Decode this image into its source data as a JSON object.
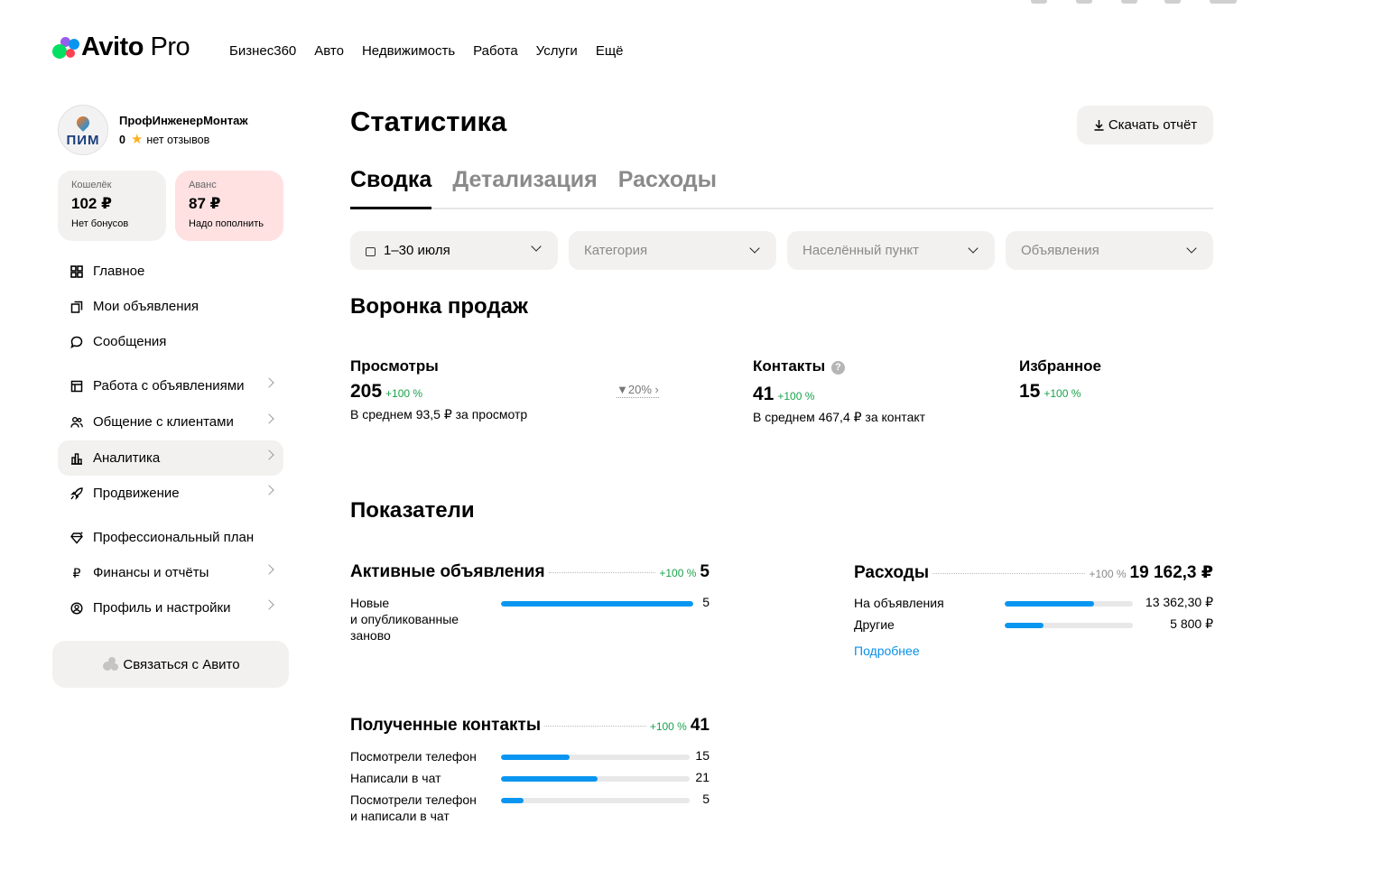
{
  "header": {
    "logo_main": "Avito",
    "logo_pro": "Pro",
    "nav": [
      "Бизнес360",
      "Авто",
      "Недвижимость",
      "Работа",
      "Услуги",
      "Ещё"
    ]
  },
  "profile": {
    "name": "ПрофИнженерМонтаж",
    "avatar_text": "ПИМ",
    "rating": "0",
    "reviews": "нет отзывов"
  },
  "wallet": {
    "label": "Кошелёк",
    "value": "102 ₽",
    "sub": "Нет бонусов"
  },
  "advance": {
    "label": "Аванс",
    "value": "87 ₽",
    "sub": "Надо пополнить"
  },
  "menu": [
    {
      "label": "Главное"
    },
    {
      "label": "Мои объявления"
    },
    {
      "label": "Сообщения"
    },
    {
      "label": "Работа с объявлениями"
    },
    {
      "label": "Общение с клиентами"
    },
    {
      "label": "Аналитика"
    },
    {
      "label": "Продвижение"
    },
    {
      "label": "Профессиональный план"
    },
    {
      "label": "Финансы и отчёты"
    },
    {
      "label": "Профиль и настройки"
    }
  ],
  "contact_button": "Связаться с Авито",
  "page": {
    "title": "Статистика",
    "download": "Скачать отчёт",
    "tabs": [
      "Сводка",
      "Детализация",
      "Расходы"
    ]
  },
  "filters": {
    "period": "1–30 июля",
    "category": "Категория",
    "location": "Населённый пункт",
    "ads": "Объявления"
  },
  "funnel": {
    "title": "Воронка продаж",
    "views": {
      "label": "Просмотры",
      "value": "205",
      "change": "+100 %",
      "sub": "В среднем 93,5 ₽ за просмотр"
    },
    "conversion": "20%",
    "contacts": {
      "label": "Контакты",
      "help": "?",
      "value": "41",
      "change": "+100 %",
      "sub": "В среднем 467,4 ₽ за контакт"
    },
    "favorites": {
      "label": "Избранное",
      "value": "15",
      "change": "+100 %"
    }
  },
  "indicators": {
    "title": "Показатели",
    "active_ads": {
      "label": "Активные объявления",
      "change": "+100 %",
      "value": "5",
      "rows": [
        {
          "label": "Новые\nи опубликованные\nзаново",
          "value": "5",
          "fraction": 1.0
        }
      ]
    },
    "expenses": {
      "label": "Расходы",
      "change": "+100 %",
      "value": "19 162,3 ₽",
      "rows": [
        {
          "label": "На объявления",
          "value": "13 362,30 ₽",
          "fraction": 0.7
        },
        {
          "label": "Другие",
          "value": "5 800 ₽",
          "fraction": 0.3
        }
      ],
      "more": "Подробнее"
    },
    "contacts": {
      "label": "Полученные контакты",
      "change": "+100 %",
      "value": "41",
      "rows": [
        {
          "label": "Посмотрели телефон",
          "value": "15",
          "fraction": 0.366
        },
        {
          "label": "Написали в чат",
          "value": "21",
          "fraction": 0.512
        },
        {
          "label": "Посмотрели телефон\nи написали в чат",
          "value": "5",
          "fraction": 0.122
        }
      ]
    }
  },
  "colors": {
    "accent_blue": "#0a96f0",
    "positive_green": "#18a34a",
    "advance_bg": "#ffe1e2",
    "panel_bg": "#f2f1f0"
  }
}
